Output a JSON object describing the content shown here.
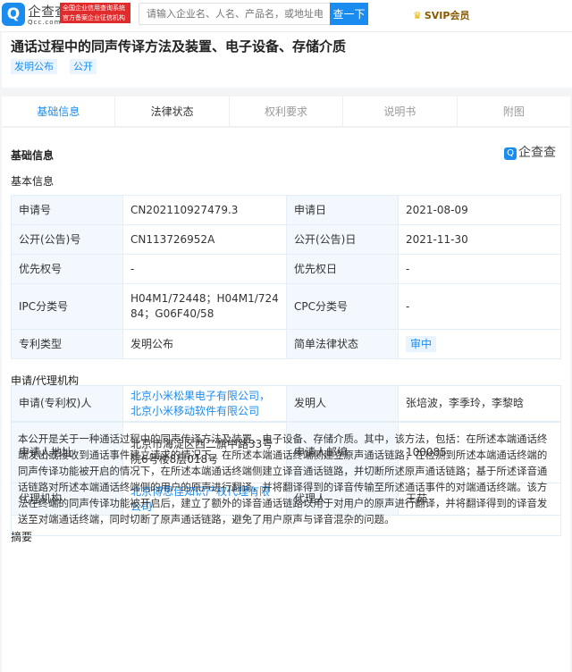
{
  "header": {
    "logo_glyph": "Q",
    "logo_name": "企查查",
    "logo_sub": "Qcc.com",
    "badge_line1": "全国企业信用查询系统",
    "badge_line2": "官方备案企业征信机构",
    "search_placeholder": "请输入企业名、人名、产品名，或地址电话/经营范围",
    "search_button": "查一下",
    "svip_label": "SVIP会员"
  },
  "patent": {
    "title": "通话过程中的同声传译方法及装置、电子设备、存储介质",
    "tags": [
      "发明公布",
      "公开"
    ]
  },
  "tabs": [
    "基础信息",
    "法律状态",
    "权利要求",
    "说明书",
    "附图"
  ],
  "section": {
    "title": "基础信息",
    "brand": "企查查",
    "basic_title": "基本信息",
    "agency_title": "申请/代理机构",
    "abstract_title": "摘要"
  },
  "basic": [
    [
      "申请号",
      "CN202110927479.3",
      "申请日",
      "2021-08-09"
    ],
    [
      "公开(公告)号",
      "CN113726952A",
      "公开(公告)日",
      "2021-11-30"
    ],
    [
      "优先权号",
      "-",
      "优先权日",
      "-"
    ],
    [
      "IPC分类号",
      "H04M1/72448；H04M1/72484；G06F40/58",
      "CPC分类号",
      "-"
    ],
    [
      "专利类型",
      "发明公布",
      "简单法律状态",
      "审中"
    ]
  ],
  "agency": [
    [
      "申请(专利权)人",
      "北京小米松果电子有限公司，北京小米移动软件有限公司",
      "发明人",
      "张培波，李季玲，李黎晗"
    ],
    [
      "申请人地址",
      "北京市海淀区西二旗中路33号院6号楼8层018号",
      "申请人邮编",
      "100085"
    ],
    [
      "代理机构",
      "北京博思佳知识产权代理有限公司",
      "代理人",
      "王茹"
    ]
  ],
  "abstract": "本公开是关于一种通话过程中的同声传译方法及装置、电子设备、存储介质。其中，该方法，包括：在所述本端通话终端发出或接收到通话事件建立请求的情况下，在所述本端通话终端侧建立原声通话链路；在检测到所述本端通话终端的同声传译功能被开启的情况下，在所述本端通话终端侧建立译音通话链路，并切断所述原声通话链路；基于所述译音通话链路对所述本端通话终端侧的用户的原声进行翻译，并将翻译得到的译音传输至所述通话事件的对端通话终端。该方法在终端的同声传译功能被开启后，建立了额外的译音通话链路以用于对用户的原声进行翻译，并将翻译得到的译音发送至对端通话终端，同时切断了原声通话链路，避免了用户原声与译音混杂的问题。"
}
